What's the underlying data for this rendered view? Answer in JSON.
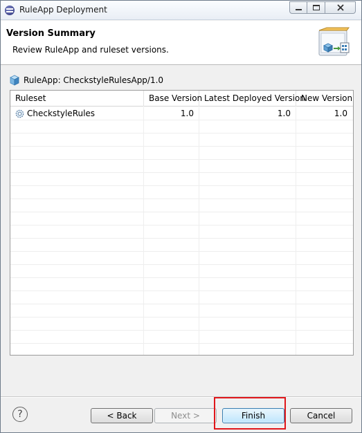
{
  "window": {
    "title": "RuleApp Deployment",
    "controls": [
      "minimize",
      "maximize",
      "close"
    ]
  },
  "banner": {
    "title": "Version Summary",
    "description": "Review RuleApp and ruleset versions.",
    "image_icon": "deployment-wizard-icon"
  },
  "ruleapp": {
    "label": "RuleApp: CheckstyleRulesApp/1.0",
    "icon": "cube-icon"
  },
  "table": {
    "columns": [
      "Ruleset",
      "Base Version",
      "Latest Deployed Version",
      "New Version"
    ],
    "rows": [
      {
        "ruleset": "CheckstyleRules",
        "base": "1.0",
        "latest": "1.0",
        "new": "1.0",
        "icon": "ruleset-gear-icon"
      }
    ]
  },
  "buttons": {
    "help": "?",
    "back": "< Back",
    "next": "Next >",
    "finish": "Finish",
    "cancel": "Cancel"
  },
  "colors": {
    "highlight": "#e0161a",
    "finish_button": "#bee6fd"
  }
}
